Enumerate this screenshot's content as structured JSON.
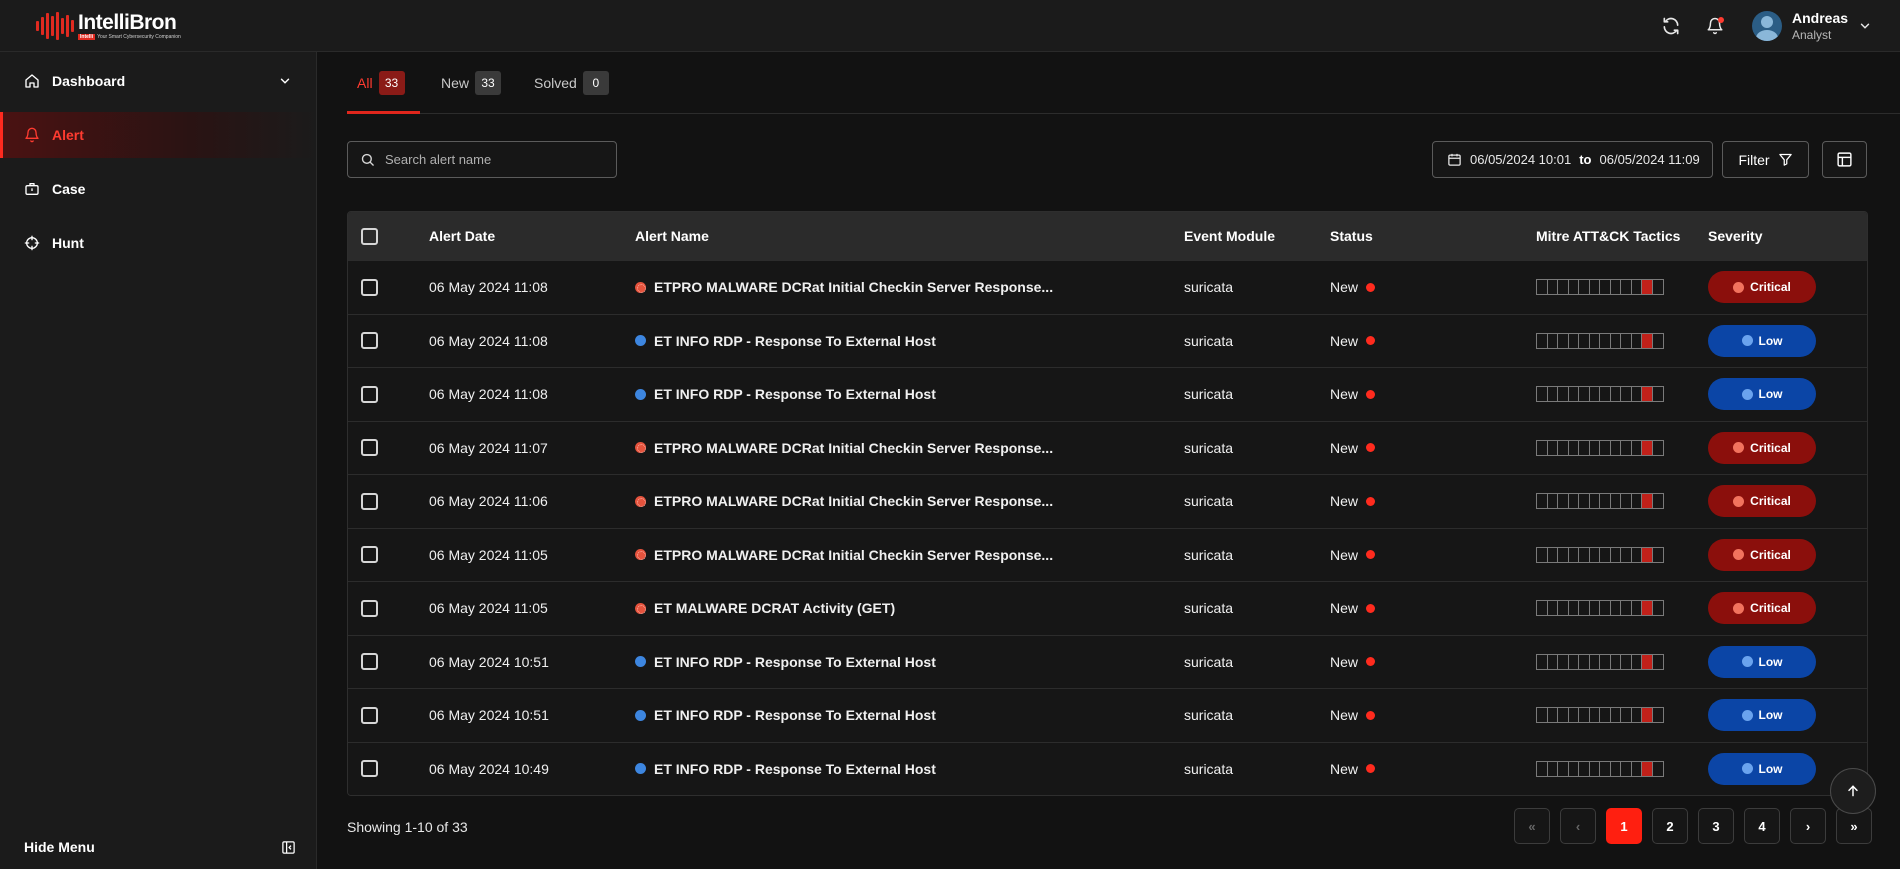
{
  "brand": {
    "name": "IntelliBron",
    "tag_highlight": "Intelli",
    "tagline": "Your Smart Cybersecurity Companion"
  },
  "user": {
    "name": "Andreas",
    "role": "Analyst"
  },
  "sidebar": {
    "items": [
      {
        "label": "Dashboard",
        "icon": "home-icon"
      },
      {
        "label": "Alert",
        "icon": "bell-icon"
      },
      {
        "label": "Case",
        "icon": "briefcase-icon"
      },
      {
        "label": "Hunt",
        "icon": "crosshair-icon"
      }
    ],
    "hide_menu": "Hide Menu"
  },
  "tabs": [
    {
      "label": "All",
      "count": "33"
    },
    {
      "label": "New",
      "count": "33"
    },
    {
      "label": "Solved",
      "count": "0"
    }
  ],
  "search": {
    "placeholder": "Search alert name"
  },
  "date_range": {
    "from": "06/05/2024 10:01",
    "to_label": "to",
    "to": "06/05/2024 11:09"
  },
  "filter": {
    "label": "Filter"
  },
  "table": {
    "headers": {
      "alert_date": "Alert Date",
      "alert_name": "Alert Name",
      "event_module": "Event Module",
      "status": "Status",
      "mitre": "Mitre ATT&CK Tactics",
      "severity": "Severity"
    },
    "rows": [
      {
        "date": "06 May 2024 11:08",
        "name": "ETPRO MALWARE DCRat Initial Checkin Server Response...",
        "module": "suricata",
        "status": "New",
        "severity": "Critical",
        "level": "critical"
      },
      {
        "date": "06 May 2024 11:08",
        "name": "ET INFO RDP - Response To External Host",
        "module": "suricata",
        "status": "New",
        "severity": "Low",
        "level": "low"
      },
      {
        "date": "06 May 2024 11:08",
        "name": "ET INFO RDP - Response To External Host",
        "module": "suricata",
        "status": "New",
        "severity": "Low",
        "level": "low"
      },
      {
        "date": "06 May 2024 11:07",
        "name": "ETPRO MALWARE DCRat Initial Checkin Server Response...",
        "module": "suricata",
        "status": "New",
        "severity": "Critical",
        "level": "critical"
      },
      {
        "date": "06 May 2024 11:06",
        "name": "ETPRO MALWARE DCRat Initial Checkin Server Response...",
        "module": "suricata",
        "status": "New",
        "severity": "Critical",
        "level": "critical"
      },
      {
        "date": "06 May 2024 11:05",
        "name": "ETPRO MALWARE DCRat Initial Checkin Server Response...",
        "module": "suricata",
        "status": "New",
        "severity": "Critical",
        "level": "critical"
      },
      {
        "date": "06 May 2024 11:05",
        "name": "ET MALWARE DCRAT Activity (GET)",
        "module": "suricata",
        "status": "New",
        "severity": "Critical",
        "level": "critical"
      },
      {
        "date": "06 May 2024 10:51",
        "name": "ET INFO RDP - Response To External Host",
        "module": "suricata",
        "status": "New",
        "severity": "Low",
        "level": "low"
      },
      {
        "date": "06 May 2024 10:51",
        "name": "ET INFO RDP - Response To External Host",
        "module": "suricata",
        "status": "New",
        "severity": "Low",
        "level": "low"
      },
      {
        "date": "06 May 2024 10:49",
        "name": "ET INFO RDP - Response To External Host",
        "module": "suricata",
        "status": "New",
        "severity": "Low",
        "level": "low"
      }
    ],
    "mitre_segments": 12,
    "mitre_active_segment": 10
  },
  "pagination": {
    "showing": "Showing 1-10 of 33",
    "pages": [
      "1",
      "2",
      "3",
      "4"
    ],
    "current": "1",
    "first": "«",
    "prev": "‹",
    "next": "›",
    "last": "»"
  },
  "colors": {
    "accent": "#ff2a1f",
    "critical_badge": "#8b0f0c",
    "low_badge": "#0b45a6",
    "status_dot": "#ff2b1e"
  }
}
